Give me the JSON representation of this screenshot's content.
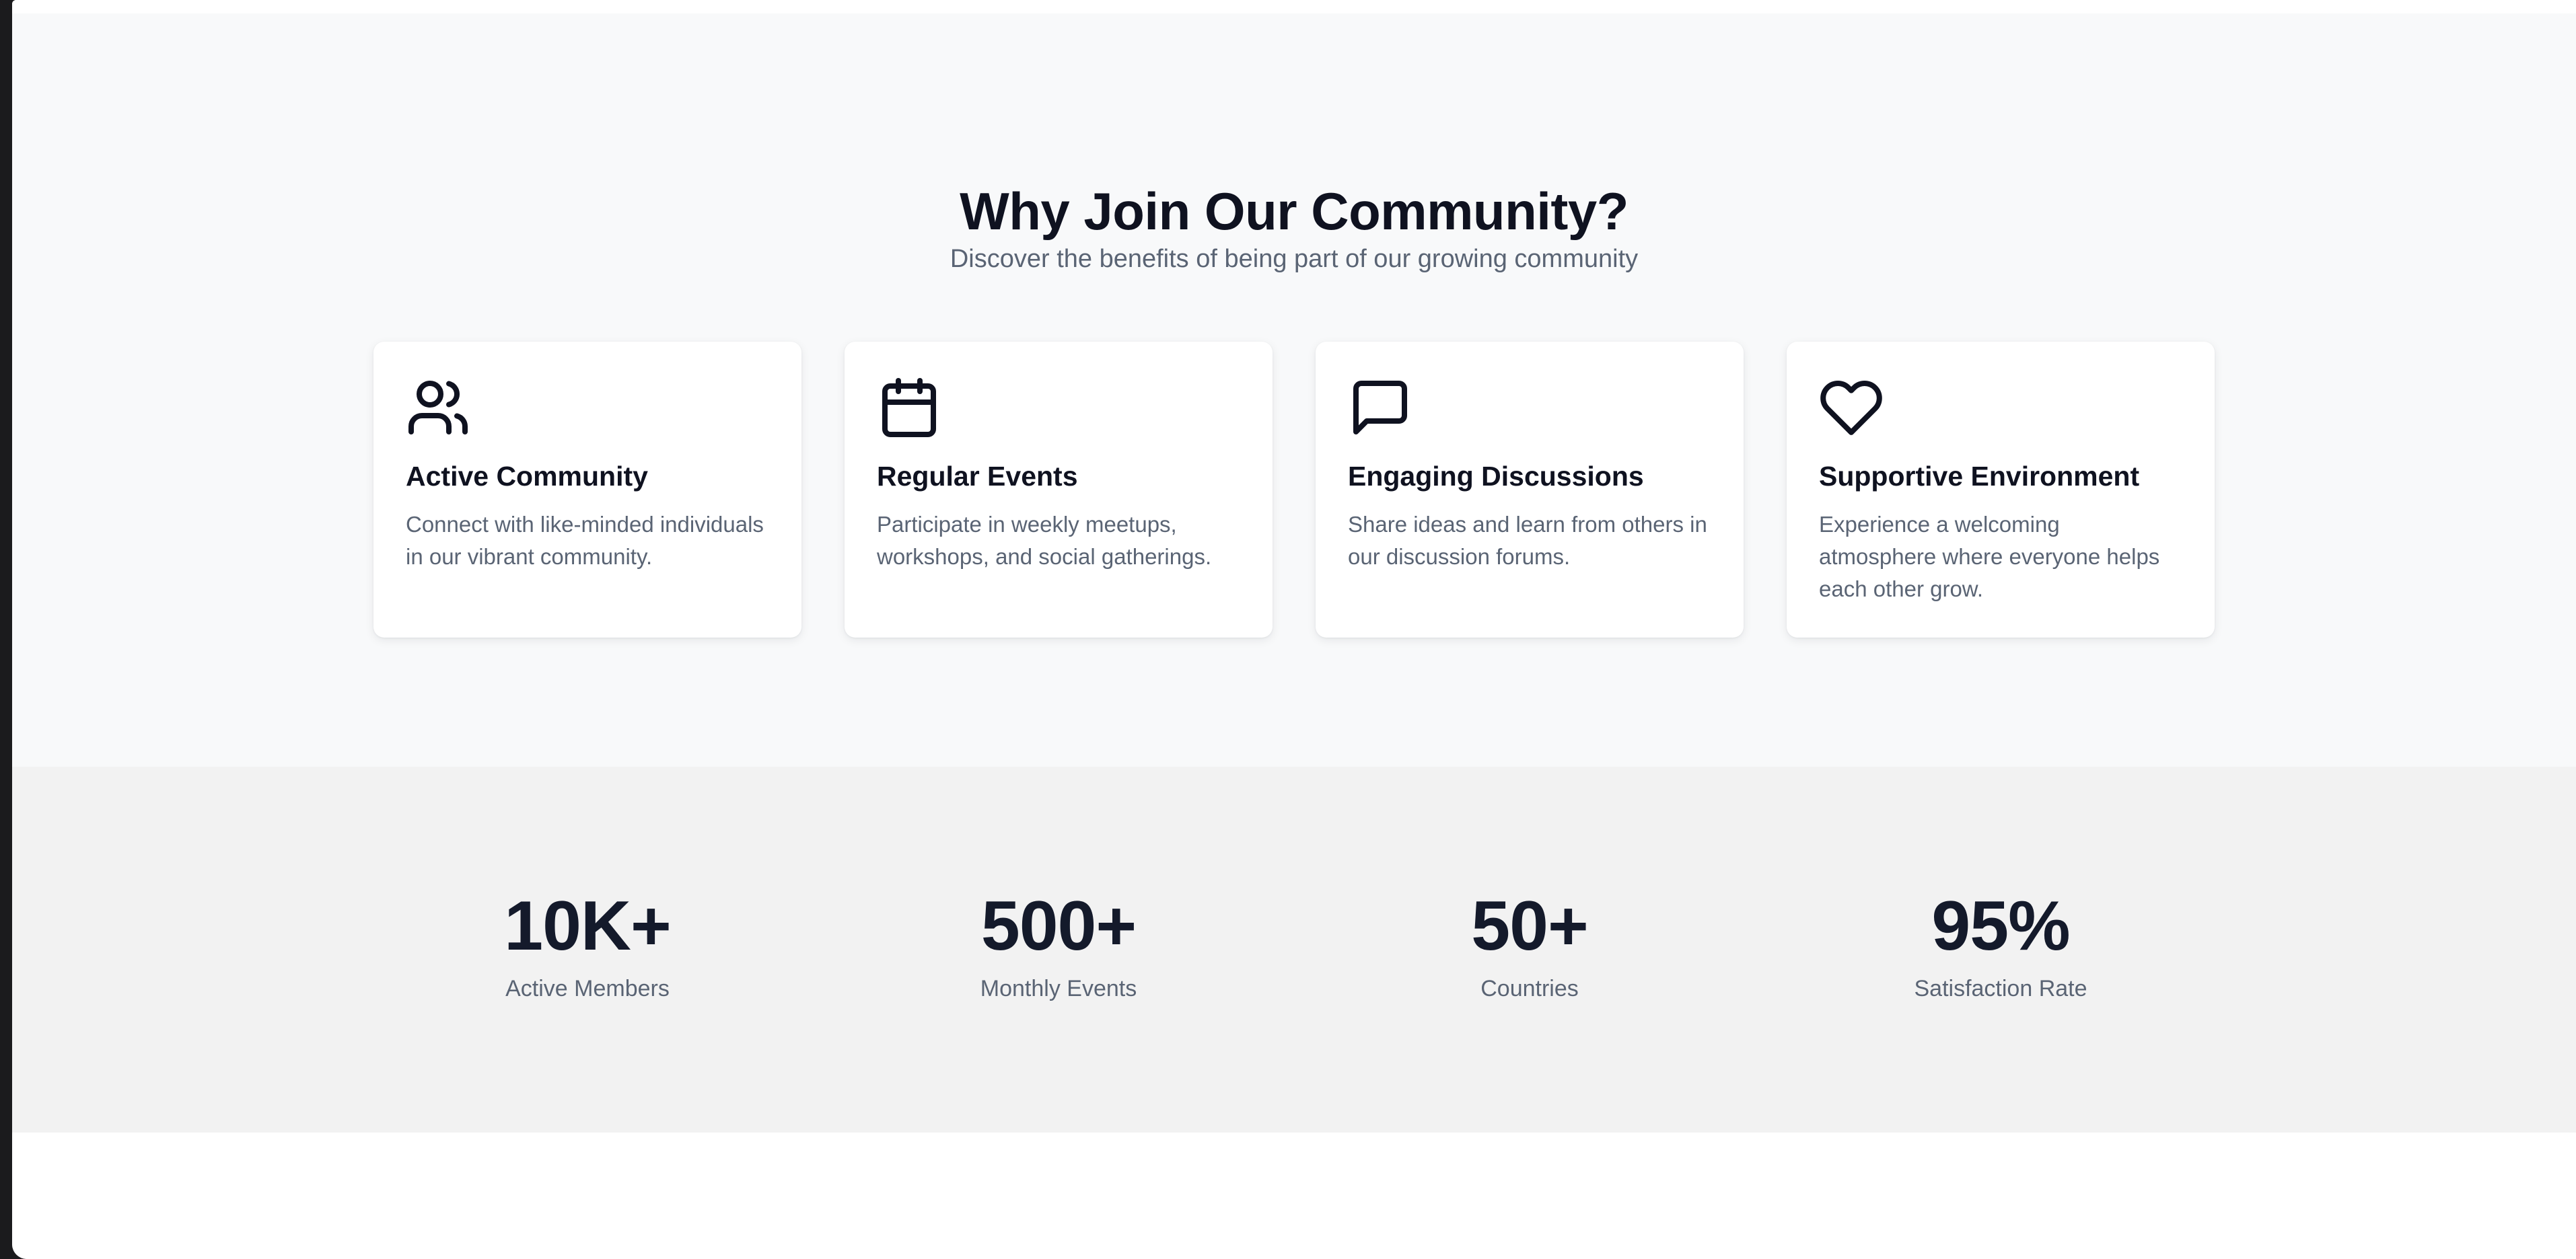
{
  "features": {
    "title": "Why Join Our Community?",
    "subtitle": "Discover the benefits of being part of our growing community",
    "cards": [
      {
        "icon": "users-icon",
        "title": "Active Community",
        "description": "Connect with like-minded individuals in our vibrant community."
      },
      {
        "icon": "calendar-icon",
        "title": "Regular Events",
        "description": "Participate in weekly meetups, workshops, and social gatherings."
      },
      {
        "icon": "message-square-icon",
        "title": "Engaging Discussions",
        "description": "Share ideas and learn from others in our discussion forums."
      },
      {
        "icon": "heart-icon",
        "title": "Supportive Environment",
        "description": "Experience a welcoming atmosphere where everyone helps each other grow."
      }
    ]
  },
  "stats": [
    {
      "value": "10K+",
      "label": "Active Members"
    },
    {
      "value": "500+",
      "label": "Monthly Events"
    },
    {
      "value": "50+",
      "label": "Countries"
    },
    {
      "value": "95%",
      "label": "Satisfaction Rate"
    }
  ],
  "colors": {
    "heading": "#0f1220",
    "muted": "#5a6474",
    "features_bg": "#f8f9fa",
    "stats_bg": "#f2f2f2"
  }
}
